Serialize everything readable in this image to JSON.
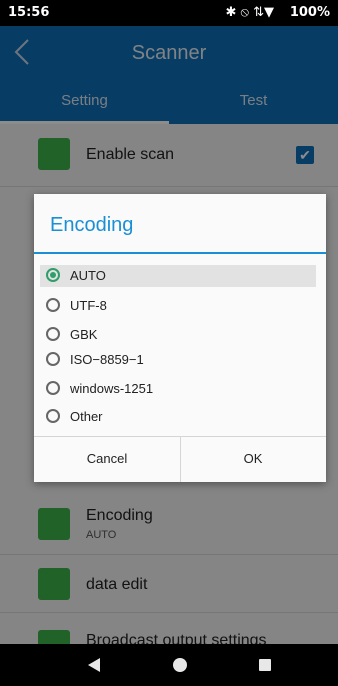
{
  "status_bar": {
    "time": "15:56",
    "battery": "100%",
    "icons": "✱ ⦸ ⇅▼"
  },
  "app_bar": {
    "title": "Scanner"
  },
  "tabs": [
    {
      "label": "Setting"
    },
    {
      "label": "Test"
    }
  ],
  "settings": {
    "enable_scan": {
      "label": "Enable scan",
      "checked": true,
      "check_glyph": "✔"
    },
    "encoding": {
      "label": "Encoding",
      "value": "AUTO"
    },
    "data_edit": {
      "label": "data edit"
    },
    "broadcast": {
      "label": "Broadcast output settings"
    }
  },
  "dialog": {
    "title": "Encoding",
    "options": [
      {
        "label": "AUTO",
        "selected": true
      },
      {
        "label": "UTF-8",
        "selected": false
      },
      {
        "label": "GBK",
        "selected": false
      },
      {
        "label": "ISO−8859−1",
        "selected": false
      },
      {
        "label": "windows-1251",
        "selected": false
      },
      {
        "label": "Other",
        "selected": false
      }
    ],
    "cancel_label": "Cancel",
    "ok_label": "OK"
  },
  "colors": {
    "primary": "#0e6eb6",
    "accent": "#1a8fd6",
    "icon_green": "#3bb34a",
    "radio_selected": "#2f9e6a"
  }
}
